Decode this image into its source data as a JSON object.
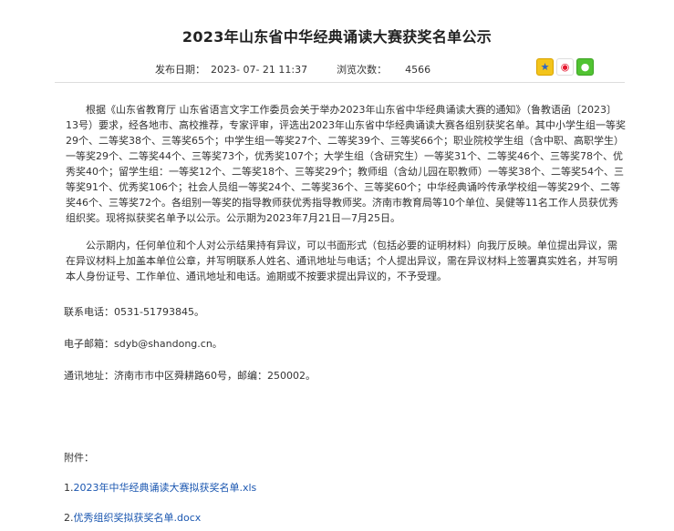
{
  "article": {
    "title": "2023年山东省中华经典诵读大赛获奖名单公示",
    "publish_label": "发布日期：",
    "publish_date": "2023- 07- 21 11:37",
    "views_label": "浏览次数：",
    "views_count": "4566"
  },
  "share": {
    "qzone_glyph": "★",
    "weibo_glyph": "◉",
    "wechat_glyph": "●",
    "colors": {
      "qzone": "#f3c41b",
      "weibo": "#e6162d",
      "wechat": "#51c332"
    }
  },
  "body": {
    "paragraph_1": "根据《山东省教育厅 山东省语言文字工作委员会关于举办2023年山东省中华经典诵读大赛的通知》（鲁教语函〔2023〕13号）要求，经各地市、高校推荐，专家评审，评选出2023年山东省中华经典诵读大赛各组别获奖名单。其中小学生组一等奖29个、二等奖38个、三等奖65个；中学生组一等奖27个、二等奖39个、三等奖66个；职业院校学生组（含中职、高职学生）一等奖29个、二等奖44个、三等奖73个，优秀奖107个；大学生组（含研究生）一等奖31个、二等奖46个、三等奖78个、优秀奖40个；留学生组：一等奖12个、二等奖18个、三等奖29个；教师组（含幼儿园在职教师）一等奖38个、二等奖54个、三等奖91个、优秀奖106个；社会人员组一等奖24个、二等奖36个、三等奖60个；中华经典诵吟传承学校组一等奖29个、二等奖46个、三等奖72个。各组别一等奖的指导教师获优秀指导教师奖。济南市教育局等10个单位、吴健等11名工作人员获优秀组织奖。现将拟获奖名单予以公示。公示期为2023年7月21日—7月25日。",
    "paragraph_2": "公示期内，任何单位和个人对公示结果持有异议，可以书面形式（包括必要的证明材料）向我厅反映。单位提出异议，需在异议材料上加盖本单位公章，并写明联系人姓名、通讯地址与电话；个人提出异议，需在异议材料上签署真实姓名，并写明本人身份证号、工作单位、通讯地址和电话。逾期或不按要求提出异议的，不予受理。",
    "phone": "联系电话：0531-51793845。",
    "email": "电子邮箱：sdyb@shandong.cn。",
    "address": "通讯地址：济南市市中区舜耕路60号，邮编：250002。"
  },
  "attachments": {
    "label": "附件：",
    "items": [
      {
        "num": "1.",
        "name": "2023年中华经典诵读大赛拟获奖名单.xls"
      },
      {
        "num": "2.",
        "name": "优秀组织奖拟获奖名单.docx"
      }
    ],
    "link_color": "#1a56b0"
  }
}
